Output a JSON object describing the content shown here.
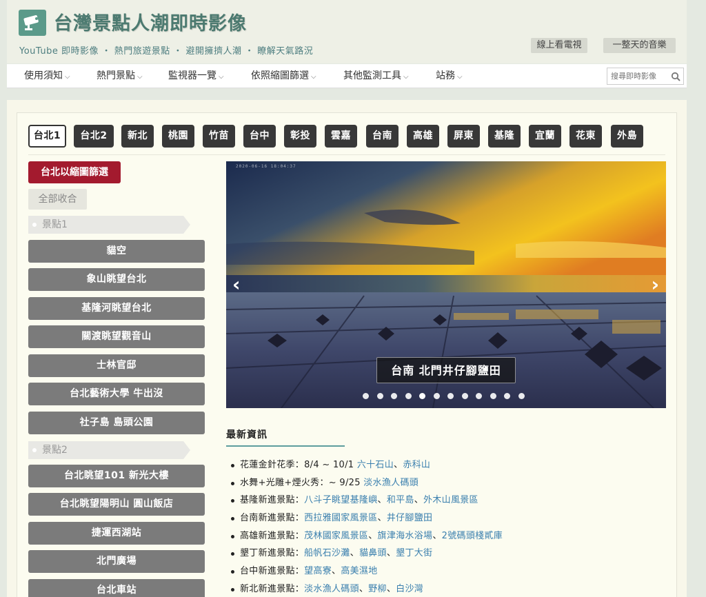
{
  "site": {
    "title": "台灣景點人潮即時影像",
    "tagline": "YouTube 即時影像 ・ 熱門旅遊景點 ・ 避開擁擠人潮 ・ 瞭解天氣路況",
    "tv_button": "線上看電視",
    "music_button": "一整天的音樂"
  },
  "nav": {
    "items": [
      {
        "label": "使用須知"
      },
      {
        "label": "熱門景點"
      },
      {
        "label": "監視器一覽"
      },
      {
        "label": "依照縮圖篩選"
      },
      {
        "label": "其他監測工具"
      },
      {
        "label": "站務"
      }
    ],
    "search_placeholder": "搜尋即時影像"
  },
  "regions": {
    "active": "台北1",
    "tabs": [
      "台北1",
      "台北2",
      "新北",
      "桃園",
      "竹苗",
      "台中",
      "彰投",
      "雲嘉",
      "台南",
      "高雄",
      "屏東",
      "基隆",
      "宜蘭",
      "花東",
      "外島"
    ]
  },
  "sidebar": {
    "filter_button": "台北以縮圖篩選",
    "collapse_button": "全部收合",
    "groups": [
      {
        "label": "景點1",
        "spots": [
          "貓空",
          "象山眺望台北",
          "基隆河眺望台北",
          "關渡眺望觀音山",
          "士林官邸",
          "台北藝術大學 牛出沒",
          "社子島 島頭公園"
        ]
      },
      {
        "label": "景點2",
        "spots": [
          "台北眺望101 新光大樓",
          "台北眺望陽明山 圓山飯店",
          "捷運西湖站",
          "北門廣場",
          "台北車站"
        ]
      }
    ]
  },
  "carousel": {
    "caption": "台南 北門井仔腳鹽田",
    "cam_stamp": "2020-06-16 18:04:37",
    "prev_label": "‹",
    "next_label": "›",
    "slide_count": 12,
    "active_slide": 4
  },
  "news": {
    "title": "最新資訊",
    "items": [
      {
        "text": "花蓮金針花季：8/4 ~ 10/1 ",
        "links": [
          "六十石山",
          "赤科山"
        ]
      },
      {
        "text": "水舞+光雕+煙火秀：~ 9/25 ",
        "links": [
          "淡水漁人碼頭"
        ]
      },
      {
        "text": "基隆新進景點：",
        "links": [
          "八斗子眺望基隆嶼",
          "和平島",
          "外木山風景區"
        ]
      },
      {
        "text": "台南新進景點：",
        "links": [
          "西拉雅國家風景區",
          "井仔腳鹽田"
        ]
      },
      {
        "text": "高雄新進景點：",
        "links": [
          "茂林國家風景區",
          "旗津海水浴場",
          "2號碼頭棧貳庫"
        ]
      },
      {
        "text": "墾丁新進景點：",
        "links": [
          "船帆石沙灘",
          "貓鼻頭",
          "墾丁大街"
        ]
      },
      {
        "text": "台中新進景點：",
        "links": [
          "望高寮",
          "高美濕地"
        ]
      },
      {
        "text": "新北新進景點：",
        "links": [
          "淡水漁人碼頭",
          "野柳",
          "白沙灣"
        ]
      }
    ]
  },
  "colors": {
    "title": "#4c7a70",
    "filter_button": "#a31a2e",
    "spot_button": "#7b7b7b",
    "link": "#3a7fae"
  }
}
